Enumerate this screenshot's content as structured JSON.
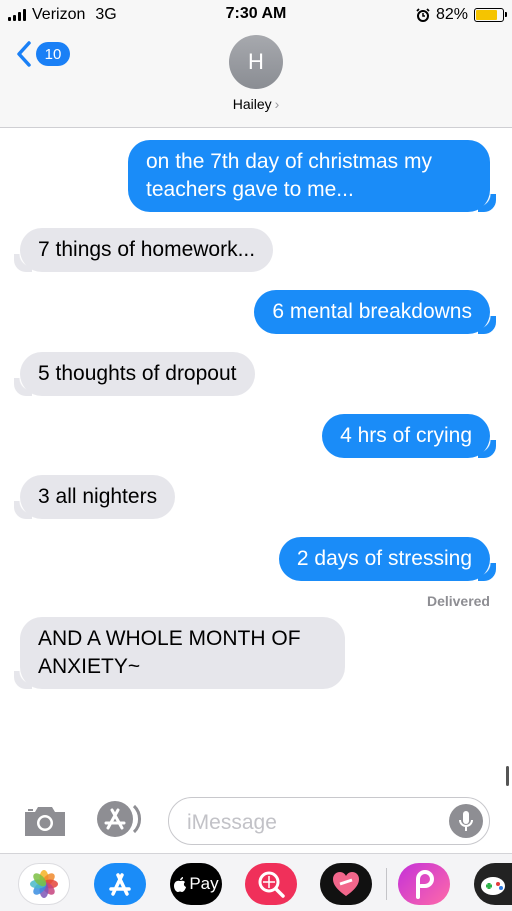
{
  "status_bar": {
    "carrier": "Verizon",
    "network": "3G",
    "time": "7:30 AM",
    "battery": "82%",
    "battery_level": 0.82,
    "battery_color": "#f5c400"
  },
  "header": {
    "back_badge": "10",
    "avatar_initial": "H",
    "contact_name": "Hailey",
    "chevron": "›"
  },
  "messages": [
    {
      "side": "out",
      "text": "on the 7th day of christmas my teachers gave to me..."
    },
    {
      "side": "in",
      "text": "7 things of homework..."
    },
    {
      "side": "out",
      "text": "6 mental breakdowns"
    },
    {
      "side": "in",
      "text": "5 thoughts of dropout"
    },
    {
      "side": "out",
      "text": "4 hrs of crying"
    },
    {
      "side": "in",
      "text": "3 all nighters"
    },
    {
      "side": "out",
      "text": "2 days of stressing"
    },
    {
      "side": "in",
      "text": "AND A WHOLE MONTH OF ANXIETY~"
    }
  ],
  "delivered_label": "Delivered",
  "input": {
    "placeholder": "iMessage"
  },
  "app_drawer": {
    "apple_pay_label": "Pay",
    "apps": [
      "photos-app-icon",
      "app-store-icon",
      "apple-pay-icon",
      "search-images-icon",
      "heart-sticker-app-icon",
      "picsart-app-icon",
      "game-app-icon"
    ]
  },
  "colors": {
    "outgoing": "#1a8cf8",
    "incoming": "#e6e6eb",
    "accent": "#1a80f6"
  }
}
